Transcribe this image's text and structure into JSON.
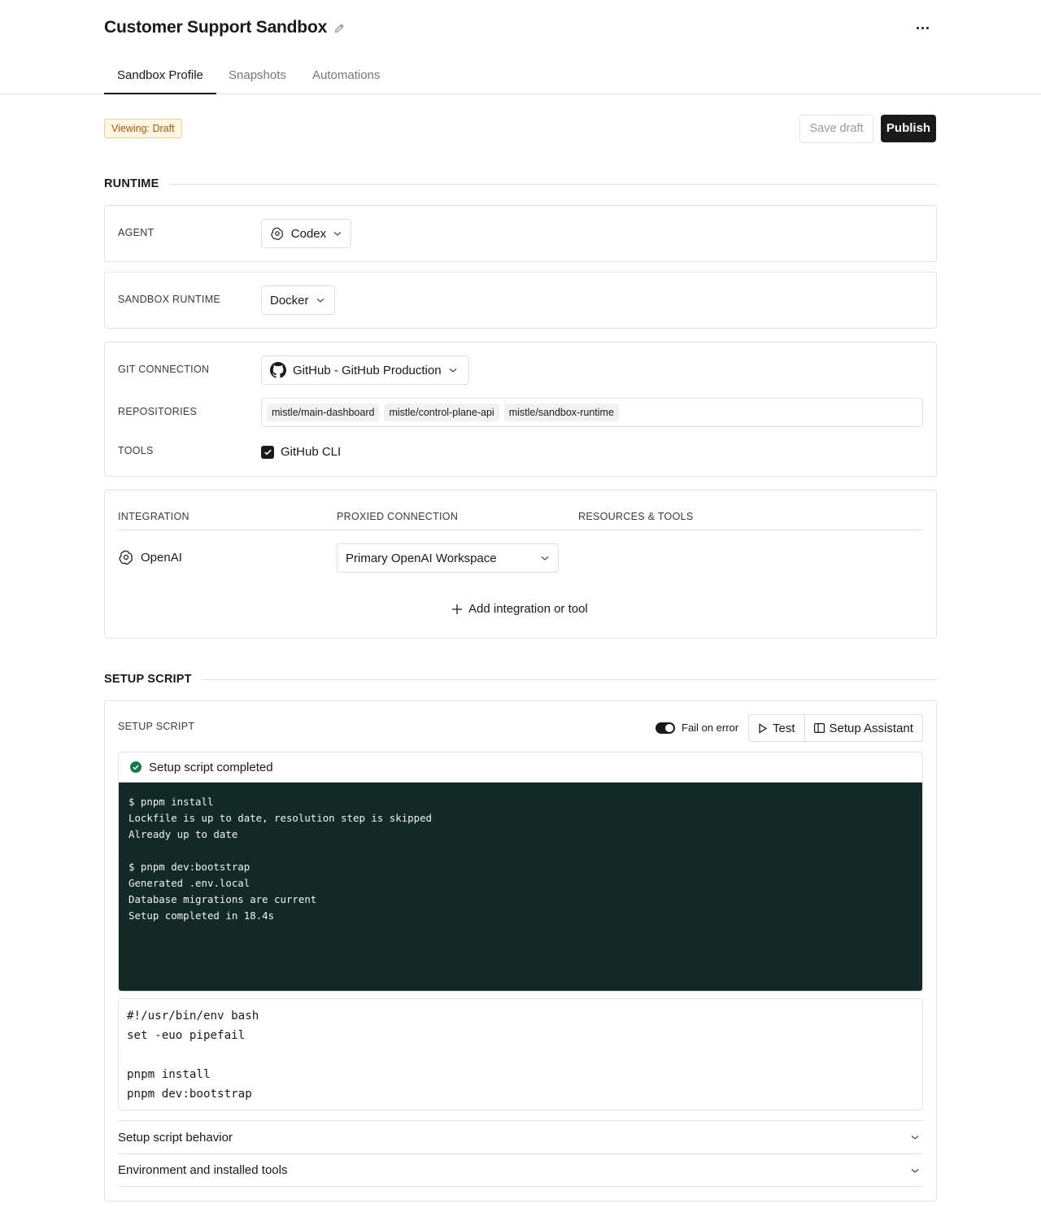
{
  "header": {
    "title": "Customer Support Sandbox"
  },
  "tabs": [
    {
      "label": "Sandbox Profile",
      "active": true
    },
    {
      "label": "Snapshots",
      "active": false
    },
    {
      "label": "Automations",
      "active": false
    }
  ],
  "toolbar": {
    "viewing_badge": "Viewing: Draft",
    "save_label": "Save draft",
    "publish_label": "Publish"
  },
  "runtime": {
    "section_title": "RUNTIME",
    "agent": {
      "label": "AGENT",
      "value": "Codex",
      "icon": "openai-icon"
    },
    "sandbox_runtime": {
      "label": "SANDBOX RUNTIME",
      "value": "Docker"
    },
    "git": {
      "connection_label": "GIT CONNECTION",
      "connection_value": "GitHub - GitHub Production",
      "repositories_label": "REPOSITORIES",
      "repositories": [
        "mistle/main-dashboard",
        "mistle/control-plane-api",
        "mistle/sandbox-runtime"
      ],
      "tools_label": "TOOLS",
      "tools": [
        {
          "label": "GitHub CLI",
          "checked": true
        }
      ]
    },
    "integrations": {
      "columns": [
        "INTEGRATION",
        "PROXIED CONNECTION",
        "RESOURCES & TOOLS"
      ],
      "rows": [
        {
          "name": "OpenAI",
          "connection": "Primary OpenAI Workspace"
        }
      ],
      "add_label": "Add integration or tool"
    }
  },
  "setup": {
    "section_title": "SETUP SCRIPT",
    "card_label": "SETUP SCRIPT",
    "fail_on_error_label": "Fail on error",
    "fail_on_error": true,
    "test_label": "Test",
    "assistant_label": "Setup Assistant",
    "status": "Setup script completed",
    "terminal_output": "$ pnpm install\nLockfile is up to date, resolution step is skipped\nAlready up to date\n\n$ pnpm dev:bootstrap\nGenerated .env.local\nDatabase migrations are current\nSetup completed in 18.4s",
    "script": "#!/usr/bin/env bash\nset -euo pipefail\n\npnpm install\npnpm dev:bootstrap",
    "accordions": [
      {
        "label": "Setup script behavior"
      },
      {
        "label": "Environment and installed tools"
      }
    ]
  },
  "colors": {
    "accent": "#1a1a1a",
    "terminal_bg": "#132925",
    "success": "#137a4f",
    "badge_text": "#b4520a"
  }
}
